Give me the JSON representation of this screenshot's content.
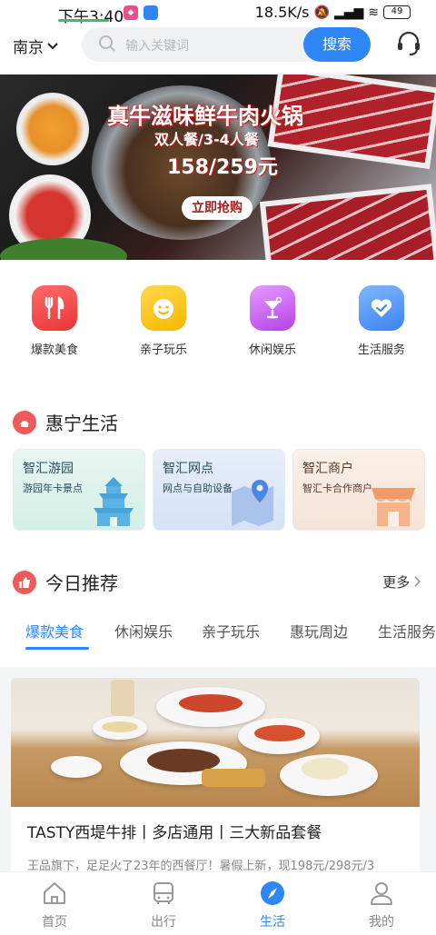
{
  "status_bar": {
    "time": "下午3:40",
    "network_speed": "18.5K/s",
    "battery": "49"
  },
  "header": {
    "city": "南京",
    "search_placeholder": "输入关键词",
    "search_button": "搜索"
  },
  "banner": {
    "title": "真牛滋味鲜牛肉火锅",
    "subtitle": "双人餐/3-4人餐",
    "price": "158/259元",
    "cta": "立即抢购"
  },
  "categories": [
    {
      "label": "爆款美食",
      "icon": "fork-knife-icon",
      "color": "#e93535"
    },
    {
      "label": "亲子玩乐",
      "icon": "smiley-face-icon",
      "color": "#f5b800"
    },
    {
      "label": "休闲娱乐",
      "icon": "cocktail-icon",
      "color": "#b640e8"
    },
    {
      "label": "生活服务",
      "icon": "heart-icon",
      "color": "#3a83ef"
    }
  ],
  "huining": {
    "title": "惠宁生活",
    "cards": [
      {
        "title": "智汇游园",
        "subtitle": "游园年卡景点",
        "icon": "pagoda-icon"
      },
      {
        "title": "智汇网点",
        "subtitle": "网点与自助设备",
        "icon": "map-pin-icon"
      },
      {
        "title": "智汇商户",
        "subtitle": "智汇卡合作商户",
        "icon": "storefront-icon"
      }
    ]
  },
  "recommend": {
    "title": "今日推荐",
    "more": "更多",
    "tabs": [
      "爆款美食",
      "休闲娱乐",
      "亲子玩乐",
      "惠玩周边",
      "生活服务"
    ],
    "active_tab": "爆款美食",
    "item": {
      "title": "TASTY西堤牛排丨多店通用丨三大新品套餐",
      "desc": "王品旗下，足足火了23年的西餐厅！暑假上新，现198元/298元/3"
    }
  },
  "bottom_nav": [
    {
      "label": "首页",
      "icon": "home-icon"
    },
    {
      "label": "出行",
      "icon": "bus-icon"
    },
    {
      "label": "生活",
      "icon": "compass-icon"
    },
    {
      "label": "我的",
      "icon": "user-icon"
    }
  ],
  "active_nav": "生活",
  "colors": {
    "accent": "#2f86f6",
    "section_dot": "#f05a5a"
  }
}
